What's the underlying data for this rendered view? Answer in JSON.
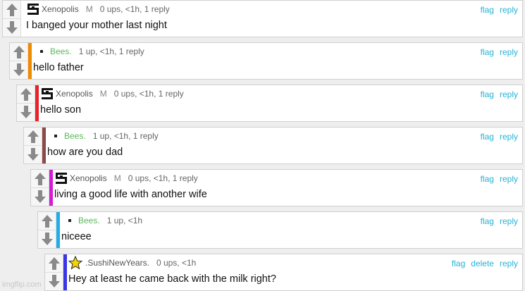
{
  "comments": [
    {
      "user": "Xenopolis",
      "mod_badge": "M",
      "meta": "0 ups, <1h, 1 reply",
      "text": "I banged your mother last night",
      "bar_color": "",
      "actions": [
        "flag",
        "reply"
      ]
    },
    {
      "user": "Bees.",
      "mod_badge": "",
      "meta": "1 up, <1h, 1 reply",
      "text": "hello father",
      "bar_color": "#f08a00",
      "actions": [
        "flag",
        "reply"
      ]
    },
    {
      "user": "Xenopolis",
      "mod_badge": "M",
      "meta": "0 ups, <1h, 1 reply",
      "text": "hello son",
      "bar_color": "#e8242b",
      "actions": [
        "flag",
        "reply"
      ]
    },
    {
      "user": "Bees.",
      "mod_badge": "",
      "meta": "1 up, <1h, 1 reply",
      "text": "how are you dad",
      "bar_color": "#8b4a4a",
      "actions": [
        "flag",
        "reply"
      ]
    },
    {
      "user": "Xenopolis",
      "mod_badge": "M",
      "meta": "0 ups, <1h, 1 reply",
      "text": "living a good life with another wife",
      "bar_color": "#d21ed2",
      "actions": [
        "flag",
        "reply"
      ]
    },
    {
      "user": "Bees.",
      "mod_badge": "",
      "meta": "1 up, <1h",
      "text": "niceee",
      "bar_color": "#21aee6",
      "actions": [
        "flag",
        "reply"
      ]
    },
    {
      "user": ".SushiNewYears.",
      "mod_badge": "",
      "meta": "0 ups, <1h",
      "text": "Hey at least he came back with the milk right?",
      "bar_color": "#3a36e6",
      "actions": [
        "flag",
        "delete",
        "reply"
      ]
    }
  ],
  "icons": {
    "upvote": "arrow-up-icon",
    "downvote": "arrow-down-icon",
    "xeno_avatar": "pixel-logo-icon",
    "bees_avatar": "small-square-icon",
    "sushi_avatar": "star-icon"
  },
  "colors": {
    "link": "#26b3d6",
    "bees_name": "#5cb85c",
    "arrow": "#8a8a8a"
  },
  "watermark": "imgflip.com"
}
